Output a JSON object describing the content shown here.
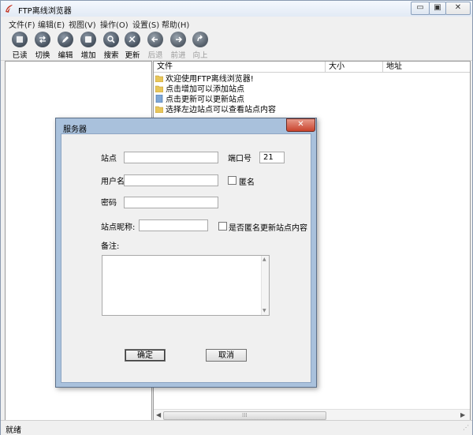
{
  "window": {
    "title": "FTP离线浏览器"
  },
  "caption_buttons": {
    "minimize": "▭",
    "maximize": "▣",
    "close": "✕"
  },
  "menu": [
    "文件(F)",
    "编辑(E)",
    "视图(V)",
    "操作(O)",
    "设置(S)",
    "帮助(H)"
  ],
  "toolbar": [
    {
      "label": "已读",
      "icon": "check-icon",
      "enabled": true
    },
    {
      "label": "切换",
      "icon": "switch-icon",
      "enabled": true
    },
    {
      "label": "编辑",
      "icon": "edit-icon",
      "enabled": true
    },
    {
      "label": "增加",
      "icon": "add-icon",
      "enabled": true
    },
    {
      "label": "搜索",
      "icon": "search-icon",
      "enabled": true
    },
    {
      "label": "更新",
      "icon": "refresh-icon",
      "enabled": true
    },
    {
      "label": "后退",
      "icon": "back-arrow-icon",
      "enabled": false
    },
    {
      "label": "前进",
      "icon": "forward-arrow-icon",
      "enabled": false
    },
    {
      "label": "向上",
      "icon": "up-icon",
      "enabled": false
    }
  ],
  "file_list": {
    "columns": [
      "文件",
      "大小",
      "地址"
    ],
    "rows": [
      {
        "name": "欢迎使用FTP离线浏览器!",
        "icon": "folder-icon"
      },
      {
        "name": "点击增加可以添加站点",
        "icon": "folder-icon"
      },
      {
        "name": "点击更新可以更新站点",
        "icon": "document-icon"
      },
      {
        "name": "选择左边站点可以查看站点内容",
        "icon": "folder-icon"
      }
    ]
  },
  "status": {
    "text": "就绪"
  },
  "dialog": {
    "title": "服务器",
    "close": "✕",
    "site_label": "站点",
    "site_value": "",
    "port_label": "端口号",
    "port_value": "21",
    "user_label": "用户名",
    "user_value": "",
    "anonymous_label": "匿名",
    "password_label": "密码",
    "password_value": "",
    "nickname_label": "站点昵称:",
    "nickname_value": "",
    "anon_update_label": "是否匿名更新站点内容",
    "notes_label": "备注:",
    "ok": "确定",
    "cancel": "取消"
  },
  "colors": {
    "dialog_frame": "#a9c1dc",
    "close_button": "#c9432d",
    "folder": "#e8c65a"
  }
}
